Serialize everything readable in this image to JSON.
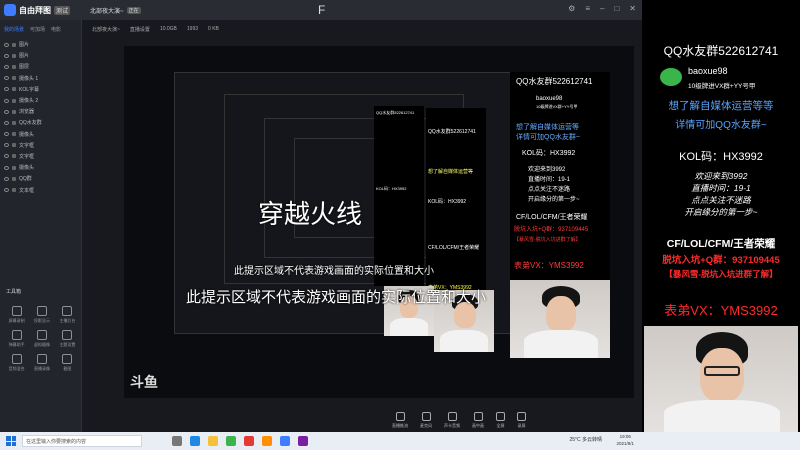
{
  "app": {
    "logo": "自由拜图",
    "logo_badge": "测试",
    "doc_tab": "北部夜大演~",
    "doc_tab_badge": "正在",
    "sidebar_tabs": [
      "我的场景",
      "可加场",
      "电影"
    ],
    "scenes": [
      "图片",
      "图片",
      "图层",
      "摄像头 1",
      "KOL字幕",
      "摄像头 2",
      "浏览器",
      "QQ水友群",
      "摄像头",
      "文字框",
      "文字框",
      "摄像头",
      "QQ群",
      "文本框"
    ],
    "tools_title": "工具箱",
    "tools": [
      "屏幕录制",
      "投影显示",
      "主播后台",
      "弹幕助手",
      "虚拟摄像",
      "主题设置",
      "音频混合",
      "直播录像",
      "截图"
    ],
    "ws_bar": [
      "北部夜大演~",
      "",
      "直播设置",
      "10.0GB",
      "1993",
      "0 KB"
    ],
    "controls": [
      "直播推流",
      "麦克风",
      "声卡音频",
      "画中画",
      "全屏",
      "录屏"
    ]
  },
  "preview": {
    "headline_big": "穿越火线",
    "caption_top": "此提示区域不代表游戏画面的实际位置和大小",
    "caption_main": "此提示区域不代表游戏画面的实际位置和大小",
    "bottom_logo": "斗鱼",
    "panel": {
      "qq": "QQ水友群522612741",
      "handle": "baoxue98",
      "handle_sub": "10级牌进VX群+YY号甲",
      "want": "想了解自媒体运营等",
      "detail": "详情可加QQ水友群~",
      "kol": "KOL码：HX3992",
      "welcome": "欢迎来到3992",
      "live_time": "直播时间：19-1",
      "click": "点点关注不迷路",
      "fate": "开启缘分的第一步~",
      "games": "CF/LOL/CFM/王者荣耀",
      "pit": "脱坑入坑+Q群：937109445",
      "storm": "【暴风雪-脱坑入坑进群了解】",
      "vx": "表弟VX：YMS3992"
    }
  },
  "right": {
    "qq": "QQ水友群522612741",
    "handle": "baoxue98",
    "handle_sub": "10级牌进VX群+YY号甲",
    "want": "想了解自媒体运营等等",
    "detail": "详情可加QQ水友群~",
    "kol": "KOL码：HX3992",
    "welcome": "欢迎来到3992",
    "live_time": "直播时间：19-1",
    "click": "点点关注不迷路",
    "fate": "开启缘分的第一步~",
    "games": "CF/LOL/CFM/王者荣耀",
    "pit": "脱坑入坑+Q群：937109445",
    "storm": "【暴风雪-脱坑入坑进群了解】",
    "vx": "表弟VX：YMS3992"
  },
  "taskbar": {
    "search_placeholder": "在这里输入你要搜索的内容",
    "weather": "25°C 多云转晴",
    "clock_time": "19:06",
    "clock_date": "2021/8/1"
  },
  "colors": {
    "accent": "#3f7cff",
    "red": "#ff2a2a",
    "yellow": "#ffd54a",
    "wechat_green": "#39b54a"
  }
}
